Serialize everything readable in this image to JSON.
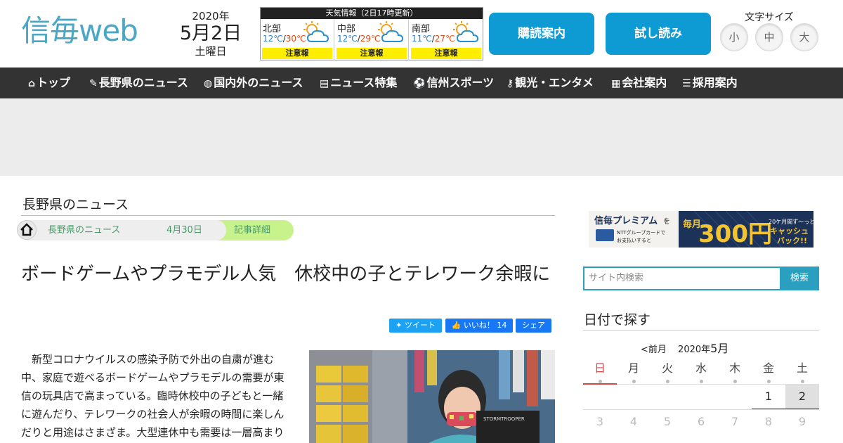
{
  "header": {
    "logo_text": "信毎web",
    "date": {
      "year": "2020年",
      "month_day": "5月2日",
      "weekday": "土曜日"
    },
    "weather": {
      "title": "天気情報（2日17時更新）",
      "regions": [
        {
          "name": "北部",
          "min": "12℃",
          "max": "30℃",
          "warning": "注意報",
          "icon": "sun-cloud-icon"
        },
        {
          "name": "中部",
          "min": "12℃",
          "max": "29℃",
          "warning": "注意報",
          "icon": "sun-cloud-icon"
        },
        {
          "name": "南部",
          "min": "11℃",
          "max": "27℃",
          "warning": "注意報",
          "icon": "sun-cloud-icon"
        }
      ]
    },
    "subscribe_label": "購読案内",
    "trial_label": "試し読み",
    "fontsize": {
      "label": "文字サイズ",
      "small": "小",
      "medium": "中",
      "large": "大"
    }
  },
  "nav": {
    "items": [
      {
        "label": "トップ",
        "icon": "home-icon"
      },
      {
        "label": "長野県のニュース",
        "icon": "pen-icon"
      },
      {
        "label": "国内外のニュース",
        "icon": "globe-icon"
      },
      {
        "label": "ニュース特集",
        "icon": "document-icon"
      },
      {
        "label": "信州スポーツ",
        "icon": "sports-icon"
      },
      {
        "label": "観光・エンタメ",
        "icon": "key-icon"
      },
      {
        "label": "会社案内",
        "icon": "building-icon"
      },
      {
        "label": "採用案内",
        "icon": "list-icon"
      }
    ]
  },
  "main": {
    "section_title": "長野県のニュース",
    "breadcrumb": [
      "長野県のニュース",
      "4月30日",
      "記事詳細"
    ],
    "headline": "ボードゲームやプラモデル人気　休校中の子とテレワーク余暇に",
    "social": {
      "tweet": "ツイート",
      "like": "いいね！ 14",
      "share": "シェア"
    },
    "article_text": "新型コロナウイルスの感染予防で外出の自粛が進む中、家庭で遊べるボードゲームやプラモデルの需要が東信の玩具店で高まっている。臨時休校中の子どもと一緒に遊んだり、テレワークの社会人が余暇の時間に楽しんだりと用途はさまざま。大型連休中も需要は一層高まりそうだ。"
  },
  "sidebar": {
    "banner": {
      "brand": "信毎プレミアム",
      "line1": "を",
      "line2": "NTTグループカードで",
      "line3": "お支払いすると",
      "monthly": "毎月",
      "amount": "300円",
      "tag1": "20ケ月間ず〜っと",
      "tag2": "キャッシュ",
      "tag3": "バック!!"
    },
    "search": {
      "placeholder": "サイト内検索",
      "button": "検索"
    },
    "calendar": {
      "title": "日付で探す",
      "prev": "<前月",
      "year": "2020年",
      "month": "5月",
      "weekdays": [
        "日",
        "月",
        "火",
        "水",
        "木",
        "金",
        "土"
      ],
      "row1": [
        "",
        "",
        "",
        "",
        "",
        "1",
        "2"
      ],
      "row2": [
        "3",
        "4",
        "5",
        "6",
        "7",
        "8",
        "9"
      ],
      "selected": "2",
      "colors": {
        "sunday": "#d04a4a",
        "selected_bg": "#e0e0e0"
      }
    }
  },
  "colors": {
    "brand": "#4aa8c6",
    "button": "#0e9ad2",
    "nav_bg": "#333333",
    "breadcrumb_active": "#c7f28c"
  }
}
